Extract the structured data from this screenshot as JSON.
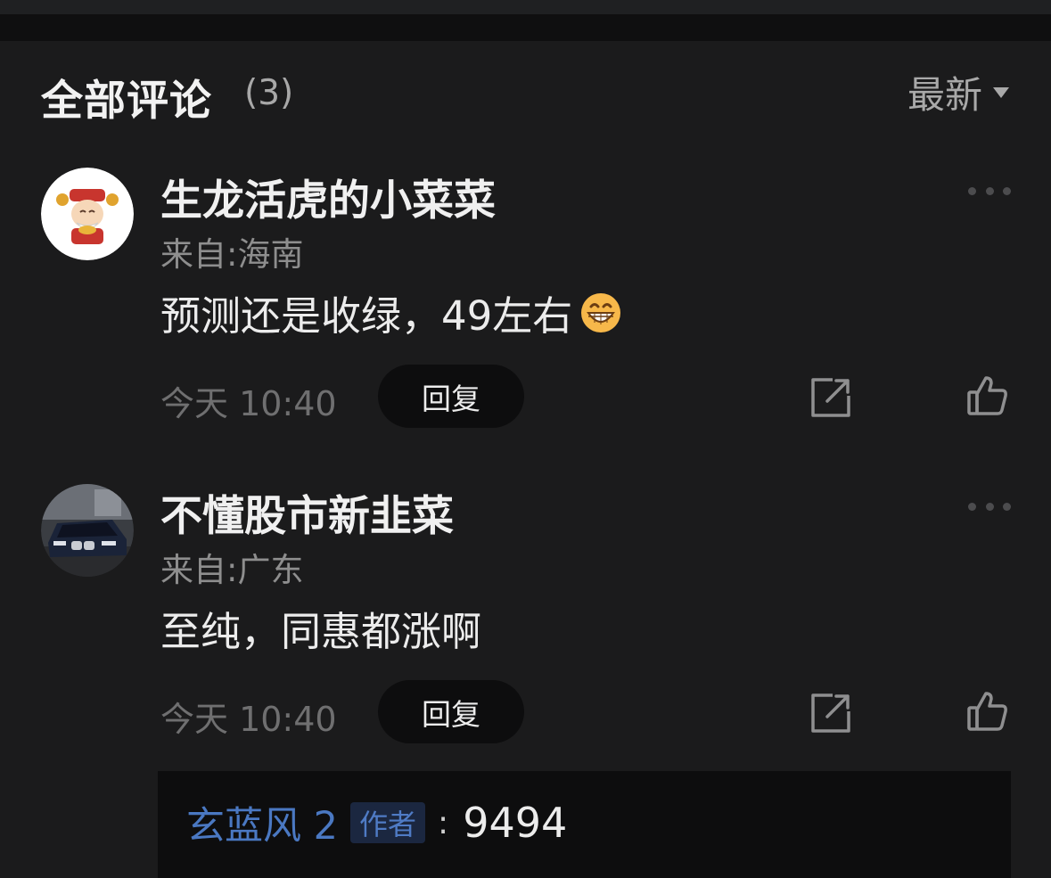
{
  "header": {
    "title": "全部评论",
    "count": "(3)",
    "sort_label": "最新",
    "sort_icon": "caret-down-icon"
  },
  "comments": [
    {
      "name": "生龙活虎的小菜菜",
      "location": "来自:海南",
      "content": "预测还是收绿，49左右",
      "emoji": "grinning-face-emoji",
      "time": "今天 10:40",
      "reply_label": "回复",
      "avatar": "caishen-cartoon-avatar",
      "icons": [
        "more-icon",
        "share-icon",
        "thumbs-up-icon"
      ]
    },
    {
      "name": "不懂股市新韭菜",
      "location": "来自:广东",
      "content": "至纯，同惠都涨啊",
      "time": "今天 10:40",
      "reply_label": "回复",
      "avatar": "car-photo-avatar",
      "icons": [
        "more-icon",
        "share-icon",
        "thumbs-up-icon"
      ],
      "sub_reply": {
        "user": "玄蓝风 2",
        "badge": "作者",
        "separator": ":",
        "text": "9494"
      }
    }
  ],
  "colors": {
    "background": "#1b1b1c",
    "link_blue": "#4a78c2",
    "muted_text": "#8e8e8e"
  }
}
